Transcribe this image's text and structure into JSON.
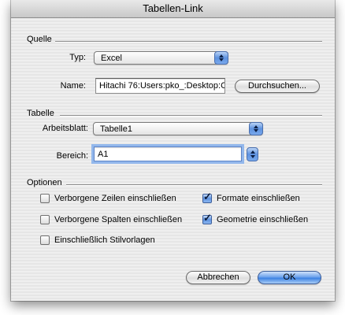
{
  "window": {
    "title": "Tabellen-Link"
  },
  "quelle": {
    "heading": "Quelle",
    "type_label": "Typ:",
    "type_value": "Excel",
    "name_label": "Name:",
    "name_value": "Hitachi 76:Users:pko_:Desktop:C",
    "browse_label": "Durchsuchen..."
  },
  "tabelle": {
    "heading": "Tabelle",
    "sheet_label": "Arbeitsblatt:",
    "sheet_value": "Tabelle1",
    "range_label": "Bereich:",
    "range_value": "A1"
  },
  "optionen": {
    "heading": "Optionen",
    "items": [
      {
        "label": "Verborgene Zeilen einschließen",
        "checked": false
      },
      {
        "label": "Formate einschließen",
        "checked": true
      },
      {
        "label": "Verborgene Spalten einschließen",
        "checked": false
      },
      {
        "label": "Geometrie einschließen",
        "checked": true
      },
      {
        "label": "Einschließlich Stilvorlagen",
        "checked": false
      }
    ],
    "check_glyph": "✓"
  },
  "buttons": {
    "cancel": "Abbrechen",
    "ok": "OK"
  },
  "colors": {
    "accent": "#5e92df",
    "focus_ring": "#93b8ec"
  }
}
